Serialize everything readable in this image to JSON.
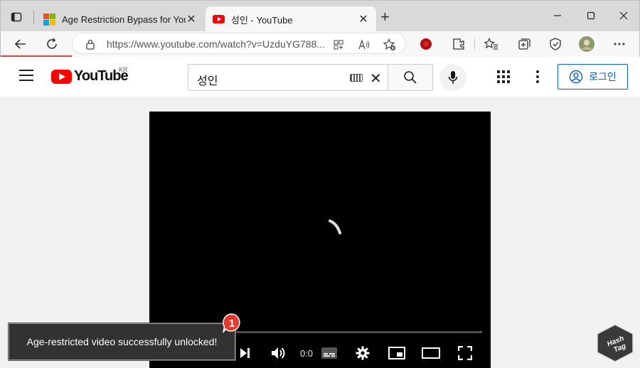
{
  "browser": {
    "tabs": [
      {
        "title": "Age Restriction Bypass for YouTub",
        "active": false,
        "favicon": "microsoft-logo"
      },
      {
        "title": "성인 - YouTube",
        "active": true,
        "favicon": "youtube-favicon"
      }
    ],
    "close_glyph": "✕",
    "new_tab_glyph": "+",
    "address": {
      "url": "https://www.youtube.com/watch?v=UzduYG788..."
    },
    "accent": "#e0433a"
  },
  "youtube": {
    "logo_text": "YouTube",
    "region": "KR",
    "search": {
      "value": "성인",
      "clear_glyph": "✕"
    },
    "login_label": "로그인",
    "brand_color": "#ff0000",
    "link_color": "#065fd4"
  },
  "player": {
    "time": "0:0",
    "progress": 0
  },
  "toast": {
    "message": "Age-restricted video successfully unlocked!",
    "badge": "1"
  },
  "watermark": {
    "lines": [
      "Hash",
      "Tag"
    ]
  }
}
